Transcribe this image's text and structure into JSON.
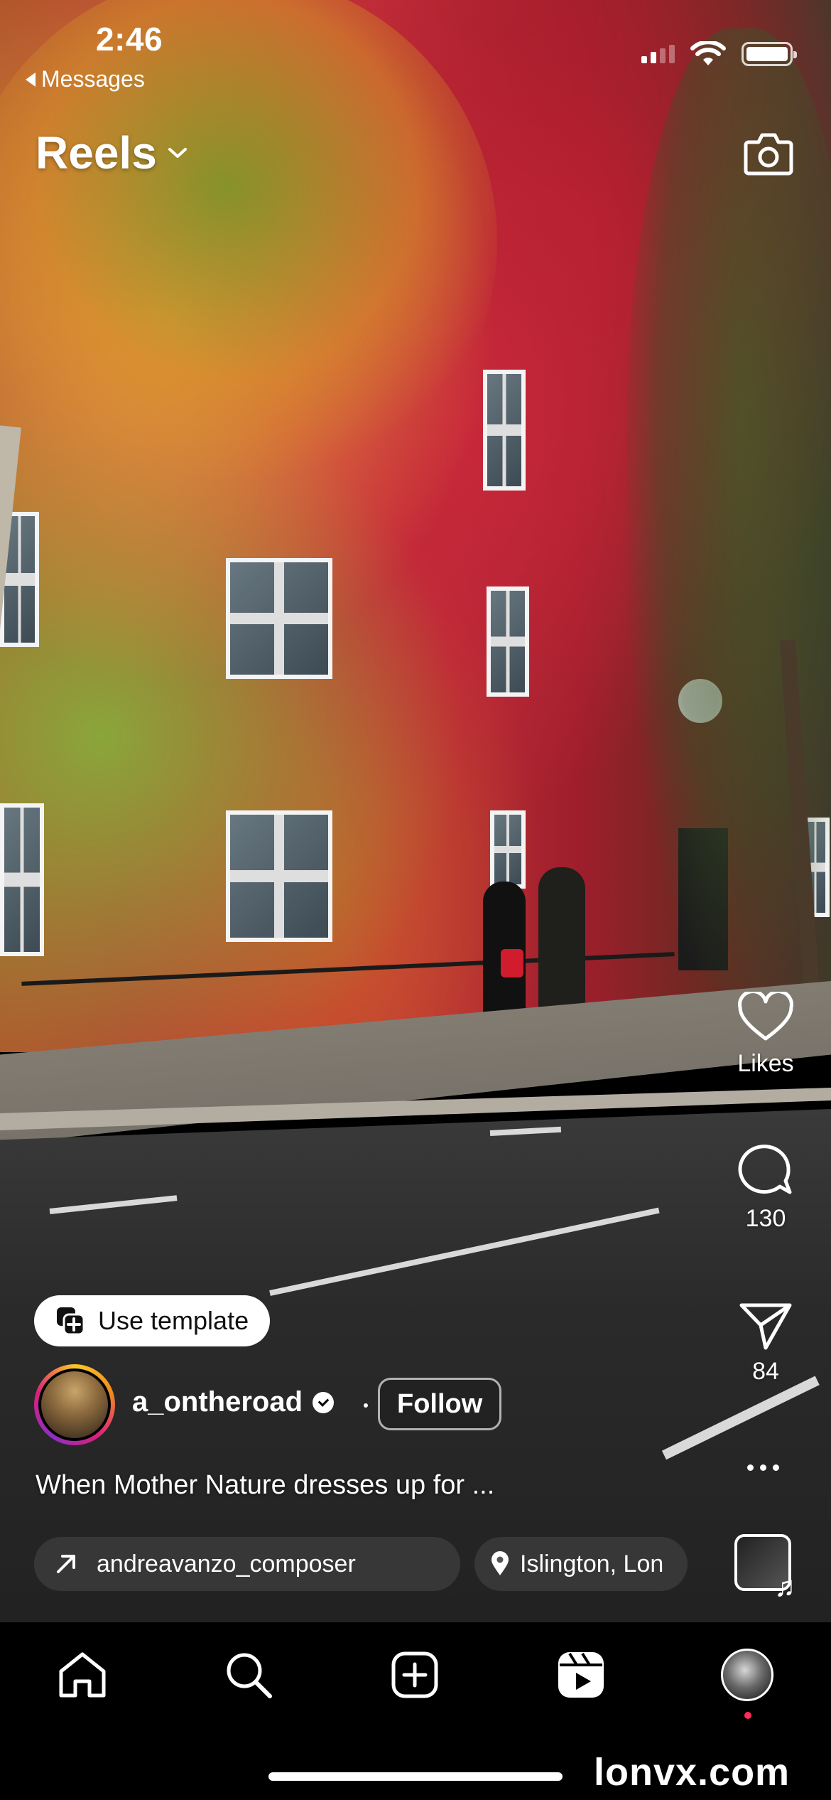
{
  "status_bar": {
    "time": "2:46",
    "back_label": "Messages"
  },
  "header": {
    "title": "Reels"
  },
  "actions": {
    "likes_label": "Likes",
    "comments_count": "130",
    "shares_count": "84"
  },
  "template_button": {
    "label": "Use template"
  },
  "author": {
    "username": "a_ontheroad",
    "follow_label": "Follow"
  },
  "caption": "When Mother Nature dresses up for ...",
  "chips": {
    "audio": "andreavanzo_composer",
    "location": "Islington, Lon"
  },
  "watermark": "lonvx.com",
  "colors": {
    "notification_dot": "#ff2d55",
    "story_ring": [
      "#f9c823",
      "#f08a24",
      "#d8217c",
      "#8c2fc4"
    ]
  },
  "nav": {
    "items": [
      "home-icon",
      "search-icon",
      "create-icon",
      "reels-icon",
      "profile-avatar"
    ]
  }
}
